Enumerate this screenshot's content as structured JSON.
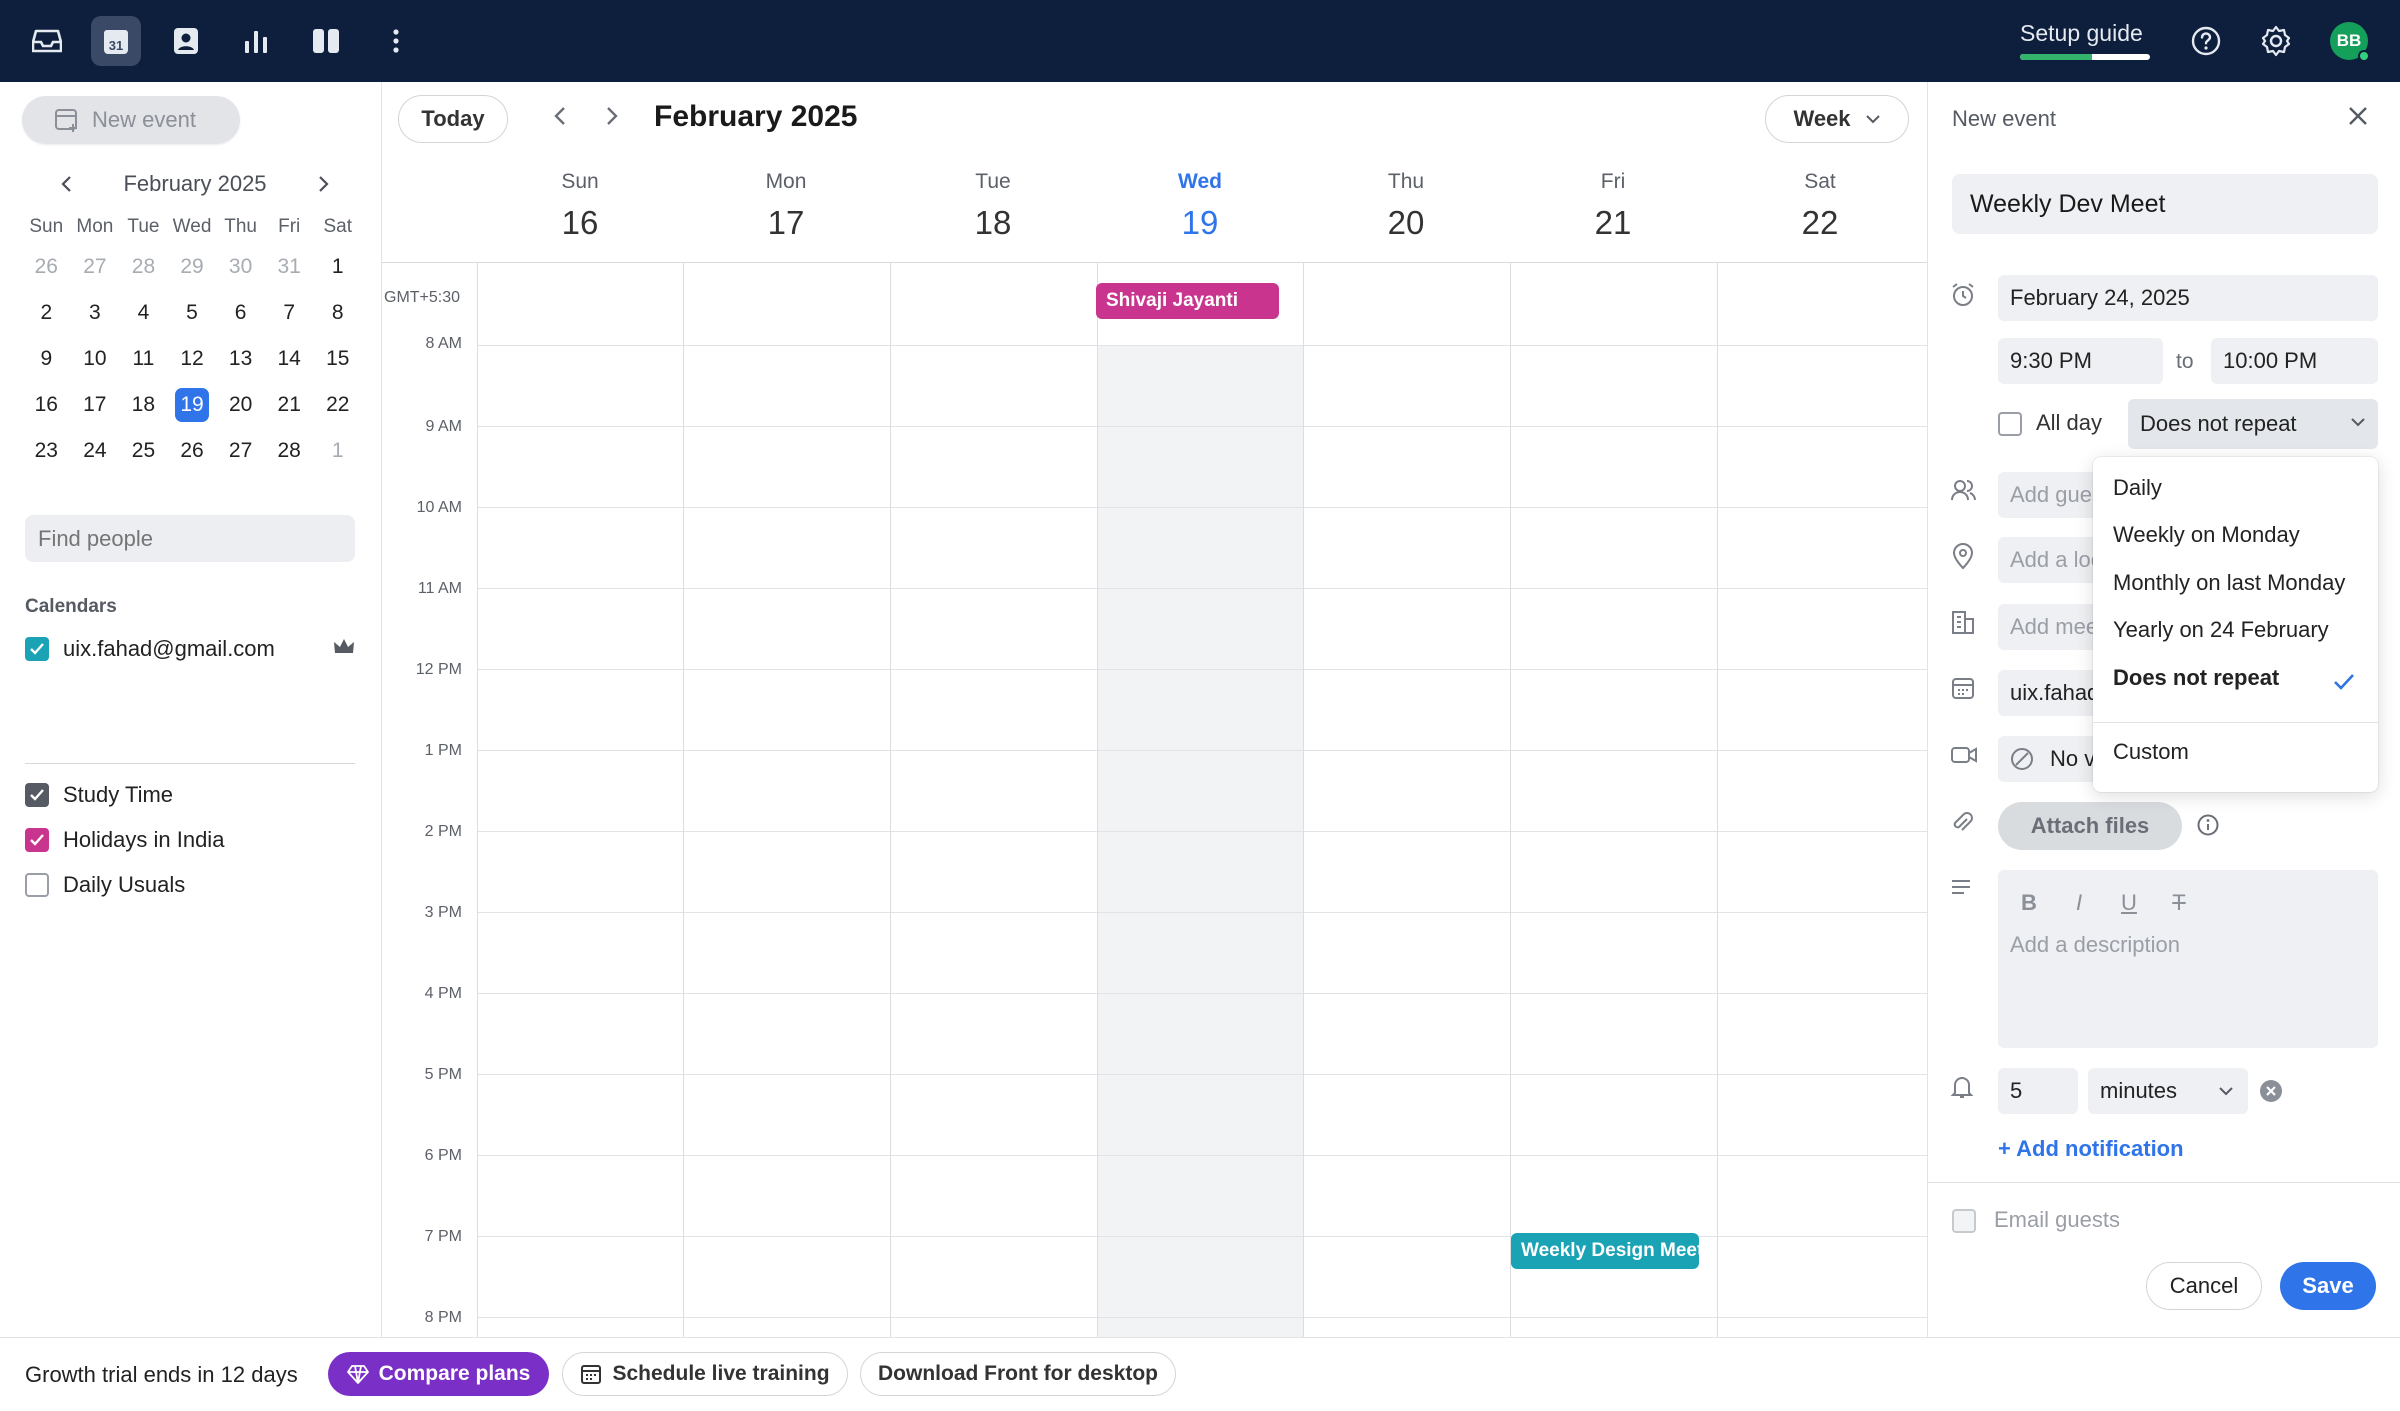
{
  "topbar": {
    "icons": [
      "inbox-icon",
      "calendar-icon",
      "contacts-icon",
      "analytics-icon",
      "layout-icon",
      "more-icon"
    ],
    "calendar_icon_day": "31",
    "setup_guide_label": "Setup guide",
    "setup_progress": 0.55,
    "avatar_initials": "BB"
  },
  "sidebar": {
    "new_event_label": "New event",
    "mini_calendar": {
      "month_label": "February 2025",
      "weekdays": [
        "Sun",
        "Mon",
        "Tue",
        "Wed",
        "Thu",
        "Fri",
        "Sat"
      ],
      "weeks": [
        [
          "26",
          "27",
          "28",
          "29",
          "30",
          "31",
          "1"
        ],
        [
          "2",
          "3",
          "4",
          "5",
          "6",
          "7",
          "8"
        ],
        [
          "9",
          "10",
          "11",
          "12",
          "13",
          "14",
          "15"
        ],
        [
          "16",
          "17",
          "18",
          "19",
          "20",
          "21",
          "22"
        ],
        [
          "23",
          "24",
          "25",
          "26",
          "27",
          "28",
          "1"
        ]
      ],
      "today": "19"
    },
    "find_people_placeholder": "Find people",
    "calendars_title": "Calendars",
    "calendars": [
      {
        "label": "uix.fahad@gmail.com",
        "checked": true,
        "color": "#1aa3b5"
      },
      {
        "label": "Study Time",
        "checked": true,
        "color": "#555a63"
      },
      {
        "label": "Holidays in India",
        "checked": true,
        "color": "#c9348e"
      },
      {
        "label": "Daily Usuals",
        "checked": false,
        "color": "#9a9ea6"
      }
    ]
  },
  "main": {
    "today_label": "Today",
    "title": "February 2025",
    "view_label": "Week",
    "timezone": "GMT+5:30",
    "days": [
      {
        "name": "Sun",
        "date": "16"
      },
      {
        "name": "Mon",
        "date": "17"
      },
      {
        "name": "Tue",
        "date": "18"
      },
      {
        "name": "Wed",
        "date": "19"
      },
      {
        "name": "Thu",
        "date": "20"
      },
      {
        "name": "Fri",
        "date": "21"
      },
      {
        "name": "Sat",
        "date": "22"
      }
    ],
    "time_labels": [
      "8 AM",
      "9 AM",
      "10 AM",
      "11 AM",
      "12 PM",
      "1 PM",
      "2 PM",
      "3 PM",
      "4 PM",
      "5 PM",
      "6 PM",
      "7 PM",
      "8 PM"
    ],
    "events": [
      {
        "title": "Shivaji Jayanti",
        "day": "Wed",
        "color": "#c9348e"
      },
      {
        "title": "Weekly Design Meeting",
        "day": "Fri",
        "color": "#1aa3b5"
      }
    ]
  },
  "panel": {
    "title": "New event",
    "event_title": "Weekly Dev Meet",
    "date": "February 24, 2025",
    "start_time": "9:30 PM",
    "to_label": "to",
    "end_time": "10:00 PM",
    "all_day_label": "All day",
    "repeat_value": "Does not repeat",
    "repeat_options": [
      "Daily",
      "Weekly on Monday",
      "Monthly on last Monday",
      "Yearly on 24 February",
      "Does not repeat",
      "Custom"
    ],
    "guests_placeholder": "Add guests",
    "location_placeholder": "Add a location",
    "meeting_room_placeholder": "Add meeting room",
    "calendar_value": "uix.fahad@gmail.com",
    "video_value": "No video call",
    "attach_label": "Attach files",
    "description_placeholder": "Add a description",
    "format_tools": [
      "B",
      "I",
      "U",
      "T"
    ],
    "notification_value": "5",
    "notification_unit": "minutes",
    "add_notification_label": "+ Add notification",
    "email_guests_label": "Email guests",
    "cancel_label": "Cancel",
    "save_label": "Save"
  },
  "footer": {
    "trial_text": "Growth trial ends in 12 days",
    "compare_label": "Compare plans",
    "training_label": "Schedule live training",
    "download_label": "Download Front for desktop"
  }
}
